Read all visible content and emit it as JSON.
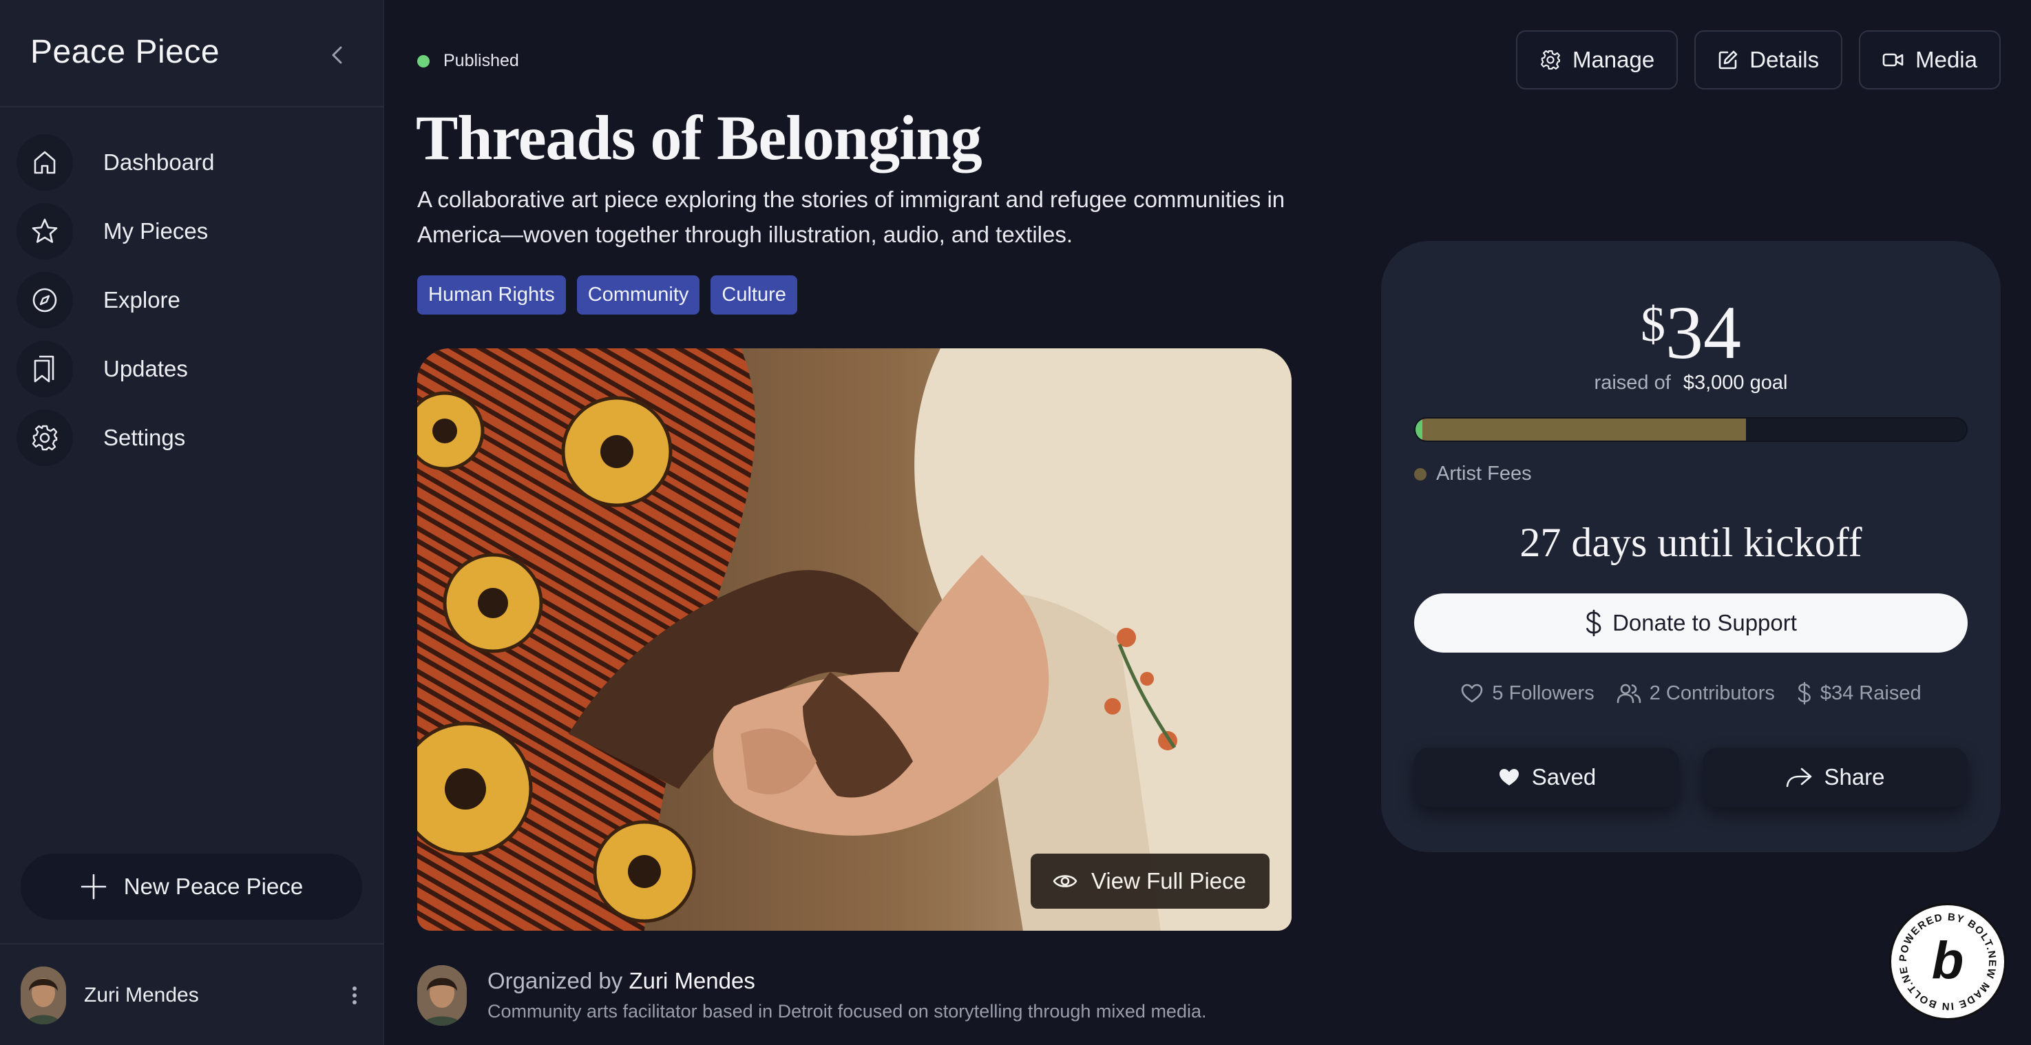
{
  "sidebar": {
    "brand": "Peace Piece",
    "items": [
      {
        "label": "Dashboard",
        "icon": "home-icon"
      },
      {
        "label": "My Pieces",
        "icon": "star-icon"
      },
      {
        "label": "Explore",
        "icon": "compass-icon"
      },
      {
        "label": "Updates",
        "icon": "bookmarks-icon"
      },
      {
        "label": "Settings",
        "icon": "gear-icon"
      }
    ],
    "new_button": "New Peace Piece",
    "user": {
      "name": "Zuri Mendes"
    }
  },
  "piece": {
    "status": "Published",
    "title": "Threads of Belonging",
    "description": "A collaborative art piece exploring the stories of immigrant and refugee communities in America—woven together through illustration, audio, and textiles.",
    "tags": [
      "Human Rights",
      "Community",
      "Culture"
    ],
    "view_button": "View Full Piece"
  },
  "toolbar": {
    "manage": "Manage",
    "details": "Details",
    "media": "Media"
  },
  "funding": {
    "currency": "$",
    "amount": "34",
    "raised_of": "raised of",
    "goal": "$3,000 goal",
    "progress_fill": 0.6,
    "legend": "Artist Fees",
    "countdown": "27 days until kickoff",
    "donate": "Donate to Support",
    "stats": {
      "followers": "5 Followers",
      "contributors": "2 Contributors",
      "raised": "$34 Raised"
    },
    "saved": "Saved",
    "share": "Share"
  },
  "organizer": {
    "prefix": "Organized by",
    "name": "Zuri Mendes",
    "bio": "Community arts facilitator based in Detroit focused on storytelling through mixed media."
  },
  "badge": {
    "text": "POWERED BY BOLT.NEW MADE IN BOLT.NEW",
    "letter": "b"
  },
  "colors": {
    "background": "#131522",
    "sidebar": "#1b1f2e",
    "tag": "#3a4aa6",
    "status_green": "#6ed37d",
    "progress": "#77693d"
  }
}
